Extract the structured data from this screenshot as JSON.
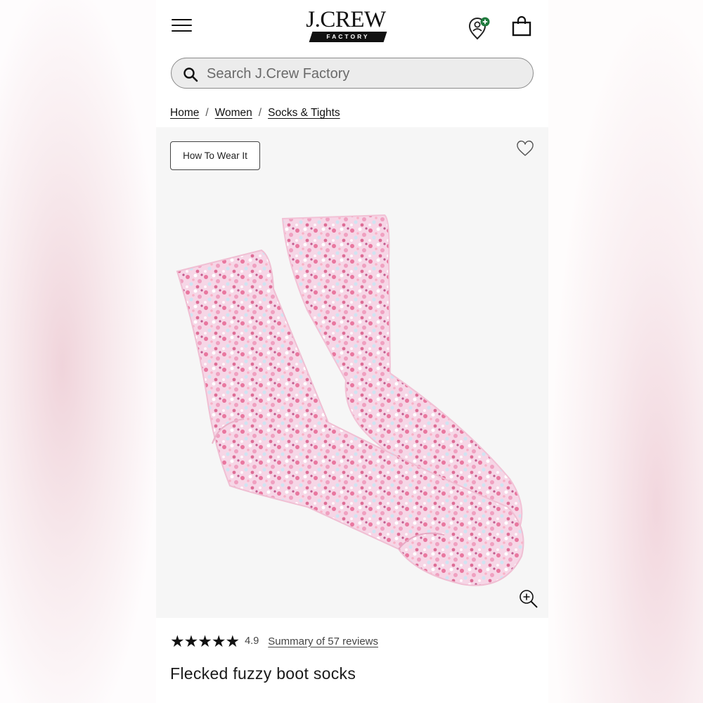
{
  "header": {
    "logo_text": "J.CREW",
    "logo_sub": "FACTORY",
    "icons": [
      "menu-icon",
      "account-icon",
      "shopping-bag-icon"
    ]
  },
  "search": {
    "placeholder": "Search J.Crew Factory",
    "value": ""
  },
  "breadcrumb": [
    {
      "label": "Home"
    },
    {
      "label": "Women"
    },
    {
      "label": "Socks & Tights"
    }
  ],
  "product": {
    "how_to_wear_label": "How To Wear It",
    "title": "Flecked fuzzy boot socks",
    "rating_stars": "★★★★★",
    "rating_value": "4.9",
    "reviews_label": "Summary of 57 reviews",
    "image_colors": {
      "base": "#f4d3e4",
      "fleck_pink": "#e9779f",
      "fleck_blue": "#cfe4f2",
      "fleck_white": "#ffffff"
    }
  },
  "colors": {
    "accent": "#111111",
    "badge": "#1f7a3d"
  }
}
